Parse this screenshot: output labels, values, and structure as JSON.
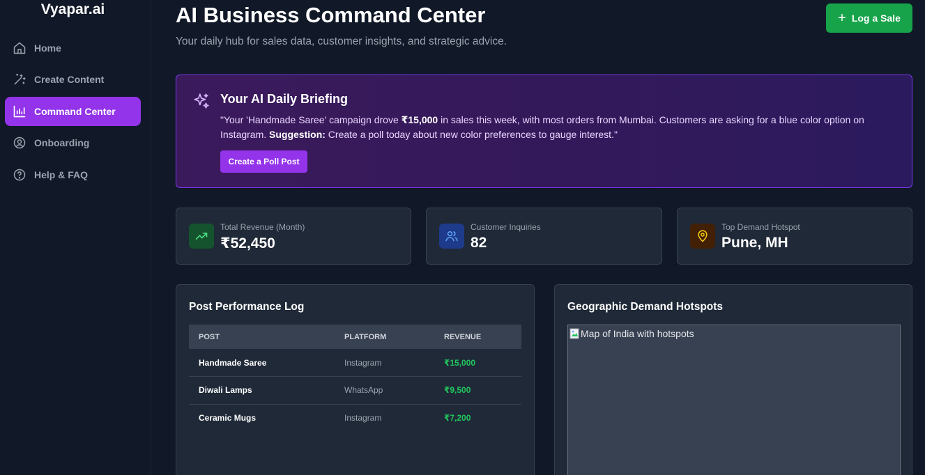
{
  "brand": "Vyapar.ai",
  "nav": [
    {
      "label": "Home",
      "icon": "home-icon"
    },
    {
      "label": "Create Content",
      "icon": "magic-wand-icon"
    },
    {
      "label": "Command Center",
      "icon": "bar-chart-icon",
      "active": true
    },
    {
      "label": "Onboarding",
      "icon": "user-circle-icon"
    },
    {
      "label": "Help & FAQ",
      "icon": "help-circle-icon"
    }
  ],
  "header": {
    "title": "AI Business Command Center",
    "subtitle": "Your daily hub for sales data, customer insights, and strategic advice.",
    "log_sale_label": "Log a Sale"
  },
  "briefing": {
    "title": "Your AI Daily Briefing",
    "text_1": "\"Your 'Handmade Saree' campaign drove ",
    "highlight_amount": "₹15,000",
    "text_2": " in sales this week, with most orders from Mumbai. Customers are asking for a blue color option on Instagram. ",
    "suggestion_label": "Suggestion:",
    "text_3": " Create a poll today about new color preferences to gauge interest.\"",
    "button_label": "Create a Poll Post"
  },
  "stats": [
    {
      "label": "Total Revenue (Month)",
      "value": "₹52,450",
      "icon": "trending-up-icon"
    },
    {
      "label": "Customer Inquiries",
      "value": "82",
      "icon": "users-icon"
    },
    {
      "label": "Top Demand Hotspot",
      "value": "Pune, MH",
      "icon": "map-pin-icon"
    }
  ],
  "post_log": {
    "title": "Post Performance Log",
    "columns": [
      "POST",
      "PLATFORM",
      "REVENUE"
    ],
    "rows": [
      {
        "post": "Handmade Saree",
        "platform": "Instagram",
        "revenue": "₹15,000"
      },
      {
        "post": "Diwali Lamps",
        "platform": "WhatsApp",
        "revenue": "₹9,500"
      },
      {
        "post": "Ceramic Mugs",
        "platform": "Instagram",
        "revenue": "₹7,200"
      }
    ]
  },
  "hotspots": {
    "title": "Geographic Demand Hotspots",
    "map_alt": "Map of India with hotspots"
  },
  "colors": {
    "accent": "#9333ea",
    "success": "#16a34a",
    "revenue_text": "#22c55e",
    "background": "#111827",
    "card": "#1f2937"
  }
}
